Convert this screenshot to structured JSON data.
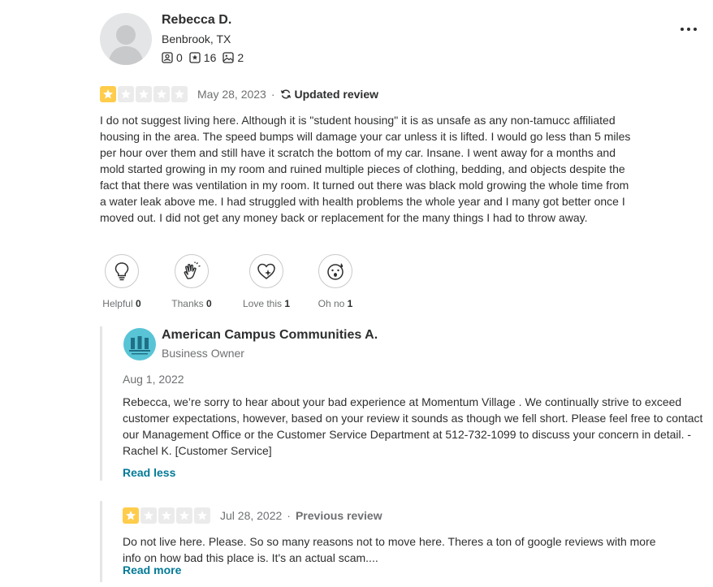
{
  "reviewer": {
    "name": "Rebecca D.",
    "location": "Benbrook, TX",
    "friends": "0",
    "reviews": "16",
    "photos": "2"
  },
  "review": {
    "rating": 1,
    "max_rating": 5,
    "date": "May 28, 2023",
    "separator": "·",
    "updated_label": "Updated review",
    "text": "I do not suggest living here. Although it is \"student housing\" it is as unsafe as any non-tamucc affiliated housing in the area. The speed bumps will damage your car unless it is lifted. I would go less than 5 miles per hour over them and still have it scratch the bottom of my car. Insane. I went away for a months and mold started growing in my room and ruined multiple pieces of clothing, bedding, and objects despite the fact that there was ventilation in my room. It turned out there was black mold growing the whole time from a water leak above me. I had struggled with health problems the whole year and I many got better once I moved out. I did not get any money back or replacement for the many things I had to throw away."
  },
  "reactions": [
    {
      "label": "Helpful",
      "count": "0",
      "icon": "lightbulb-icon"
    },
    {
      "label": "Thanks",
      "count": "0",
      "icon": "clapping-hands-icon"
    },
    {
      "label": "Love this",
      "count": "1",
      "icon": "heart-sparkle-icon"
    },
    {
      "label": "Oh no",
      "count": "1",
      "icon": "shocked-face-icon"
    }
  ],
  "owner_reply": {
    "business_name": "American Campus Communities A.",
    "role": "Business Owner",
    "date": "Aug 1, 2022",
    "text": "Rebecca, we’re sorry to hear about your bad experience at Momentum Village . We continually strive to exceed customer expectations, however, based on your review it sounds as though we fell short. Please feel free to contact our Management Office or the Customer Service Department at 512-732-1099 to discuss your concern in detail. - Rachel K. [Customer Service]",
    "read_less_label": "Read less"
  },
  "previous_review": {
    "rating": 1,
    "max_rating": 5,
    "date": "Jul 28, 2022",
    "separator": "·",
    "label": "Previous review",
    "text": "Do not live here. Please. So so many reasons not to move here. Theres a ton of google reviews with more info on how bad this place is. It's an actual scam....",
    "read_more_label": "Read more"
  },
  "colors": {
    "star_filled": "#ffcc4b",
    "star_empty": "#ebebeb",
    "link": "#027a97",
    "text": "#2d2e2f",
    "muted": "#6e7072"
  }
}
